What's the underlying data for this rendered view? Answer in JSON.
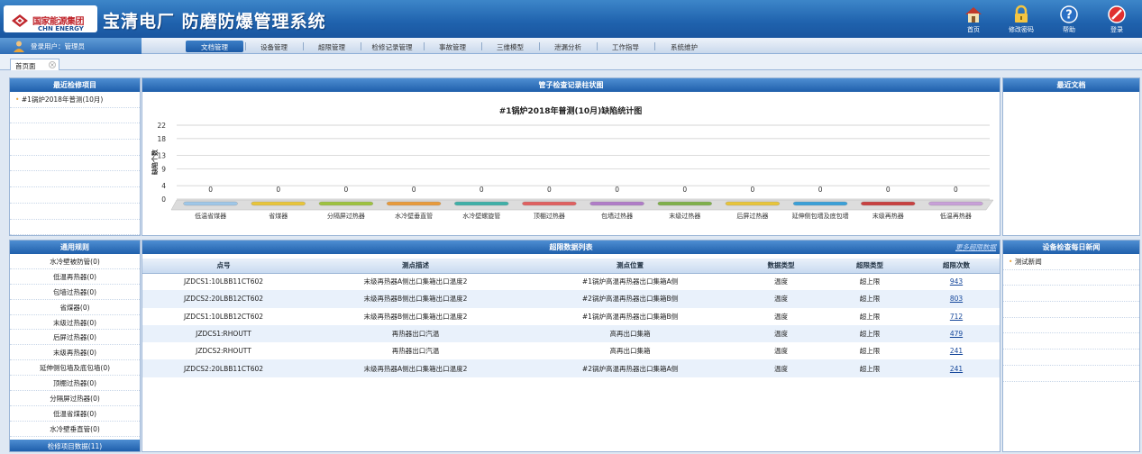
{
  "header": {
    "logo_cn": "国家能源集团",
    "logo_en": "CHN ENERGY",
    "title": "宝清电厂 防磨防爆管理系统",
    "actions": [
      {
        "label": "首页",
        "icon": "home-icon"
      },
      {
        "label": "修改密码",
        "icon": "lock-icon"
      },
      {
        "label": "帮助",
        "icon": "help-icon"
      },
      {
        "label": "登录",
        "icon": "logout-icon"
      }
    ]
  },
  "navbar": {
    "user_label": "登录用户：管理员",
    "menu": [
      "文档管理",
      "设备管理",
      "超限管理",
      "检修记录管理",
      "事故管理",
      "三维模型",
      "泄漏分析",
      "工作指导",
      "系统维护"
    ],
    "active_index": 0
  },
  "tabs": {
    "home": "首页面"
  },
  "recent_items": {
    "title": "最近检修项目",
    "items": [
      "#1锅炉2018年普测(10月)"
    ]
  },
  "rules": {
    "title": "通用规则",
    "items": [
      "水冷壁被防管(0)",
      "低温再热器(0)",
      "包墙过热器(0)",
      "省煤器(0)",
      "末级过热器(0)",
      "后屏过热器(0)",
      "末级再热器(0)",
      "延伸侧包墙及底包墙(0)",
      "顶棚过热器(0)",
      "分隔屏过热器(0)",
      "低温省煤器(0)",
      "水冷壁垂直管(0)"
    ],
    "footer": "检修项目数据(11)"
  },
  "chart_panel": {
    "title": "管子检查记录柱状图"
  },
  "chart_data": {
    "type": "bar",
    "title": "#1锅炉2018年普测(10月)缺陷统计图",
    "ylabel": "缺陷个数",
    "xlabel": "",
    "categories": [
      "低温省煤器",
      "省煤器",
      "分隔屏过热器",
      "水冷壁垂直管",
      "水冷壁螺旋管",
      "顶棚过热器",
      "包墙过热器",
      "末级过热器",
      "后屏过热器",
      "延伸侧包墙及底包墙",
      "末级再热器",
      "低温再热器"
    ],
    "values": [
      0,
      0,
      0,
      0,
      0,
      0,
      0,
      0,
      0,
      0,
      0,
      0
    ],
    "yticks": [
      0,
      4,
      9,
      13,
      18,
      22
    ],
    "ylim": [
      0,
      22
    ],
    "grid": true,
    "bar_colors": [
      "#9fc7e8",
      "#e8c53a",
      "#9ec23f",
      "#e89a3a",
      "#3fb0a8",
      "#e06060",
      "#b07cc8",
      "#7fb04a",
      "#e8c53a",
      "#3aa0d8",
      "#c84040",
      "#c8a0d8"
    ]
  },
  "table": {
    "title": "超限数据列表",
    "more": "更多超限数据",
    "columns": [
      "点号",
      "测点描述",
      "测点位置",
      "数据类型",
      "超限类型",
      "超限次数"
    ],
    "rows": [
      [
        "JZDCS1:10LBB11CT602",
        "末级再热器A侧出口集箱出口温度2",
        "#1锅炉高温再热器出口集箱A侧",
        "温度",
        "超上限",
        "943"
      ],
      [
        "JZDCS2:20LBB12CT602",
        "末级再热器B侧出口集箱出口温度2",
        "#2锅炉高温再热器出口集箱B侧",
        "温度",
        "超上限",
        "803"
      ],
      [
        "JZDCS1:10LBB12CT602",
        "末级再热器B侧出口集箱出口温度2",
        "#1锅炉高温再热器出口集箱B侧",
        "温度",
        "超上限",
        "712"
      ],
      [
        "JZDCS1:RHOUTT",
        "再热器出口汽温",
        "高再出口集箱",
        "温度",
        "超上限",
        "479"
      ],
      [
        "JZDCS2:RHOUTT",
        "再热器出口汽温",
        "高再出口集箱",
        "温度",
        "超上限",
        "241"
      ],
      [
        "JZDCS2:20LBB11CT602",
        "末级再热器A侧出口集箱出口温度2",
        "#2锅炉高温再热器出口集箱A侧",
        "温度",
        "超上限",
        "241"
      ]
    ]
  },
  "docs": {
    "title": "最近文档"
  },
  "news": {
    "title": "设备检查每日新闻",
    "items": [
      "测试新闻"
    ]
  }
}
